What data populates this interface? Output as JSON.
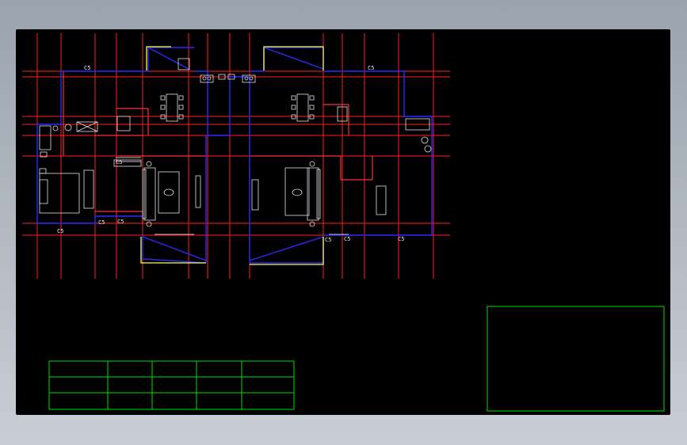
{
  "drawing": {
    "window_labels": [
      "C5",
      "C5",
      "C5",
      "C5",
      "C5",
      "C5",
      "C5",
      "C5",
      "C5"
    ],
    "colors": {
      "background": "#000000",
      "axis_lines": "#ff2020",
      "walls": "#2020ff",
      "partitions": "#ff2020",
      "furniture": "#e0e0e0",
      "balcony": "#ffff40",
      "frames": "#00ff00",
      "window": "#c0c0c0"
    },
    "schedule_table": {
      "rows": 3,
      "columns": 5,
      "cells": []
    },
    "title_block": {
      "text": ""
    }
  }
}
